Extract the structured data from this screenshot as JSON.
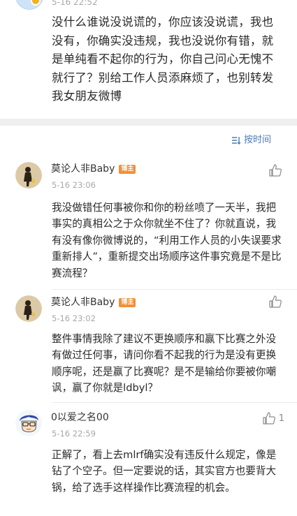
{
  "post": {
    "time": "5-16 22:52",
    "text": "没什么谁说没说谎的，你应该没说谎，我也没有，你确实没违规，我也没说你有错，就是单纯看不起你的行为，你自己问心无愧不就行了？别给工作人员添麻烦了，也别转发我女朋友微博"
  },
  "sort": {
    "label": "按时间",
    "icon": "sort-icon"
  },
  "comments": [
    {
      "name": "莫论人非Baby",
      "badge": "博主",
      "time": "5-16 23:06",
      "text": "我没做错任何事被你和你的粉丝喷了一天半，我把事实的真相公之于众你就坐不住了？你就直说，我有没有像你微博说的，“利用工作人员的小失误要求重新排人”，重新提交出场顺序这件事究竟是不是比赛流程？",
      "like_count": ""
    },
    {
      "name": "莫论人非Baby",
      "badge": "博主",
      "time": "5-16 23:02",
      "text": "整件事情我除了建议不更换顺序和赢下比赛之外没有做过任何事，请问你看不起我的行为是没有更换顺序呢，还是赢了比赛呢？是不是输给你要被你嘲讽，赢了你就是ldbyl？",
      "like_count": ""
    },
    {
      "name": "0以爱之名00",
      "badge": "",
      "time": "5-16 22:59",
      "text": "正解了，看上去mlrf确实没有违反什么规定，像是钻了个空子。但一定要说的话，其实官方也要背大锅，给了选手这样操作比赛流程的机会。",
      "like_count": "1"
    }
  ],
  "colors": {
    "accent": "#4d7bb2",
    "badge": "#f0903a",
    "separator": "#efefef"
  }
}
